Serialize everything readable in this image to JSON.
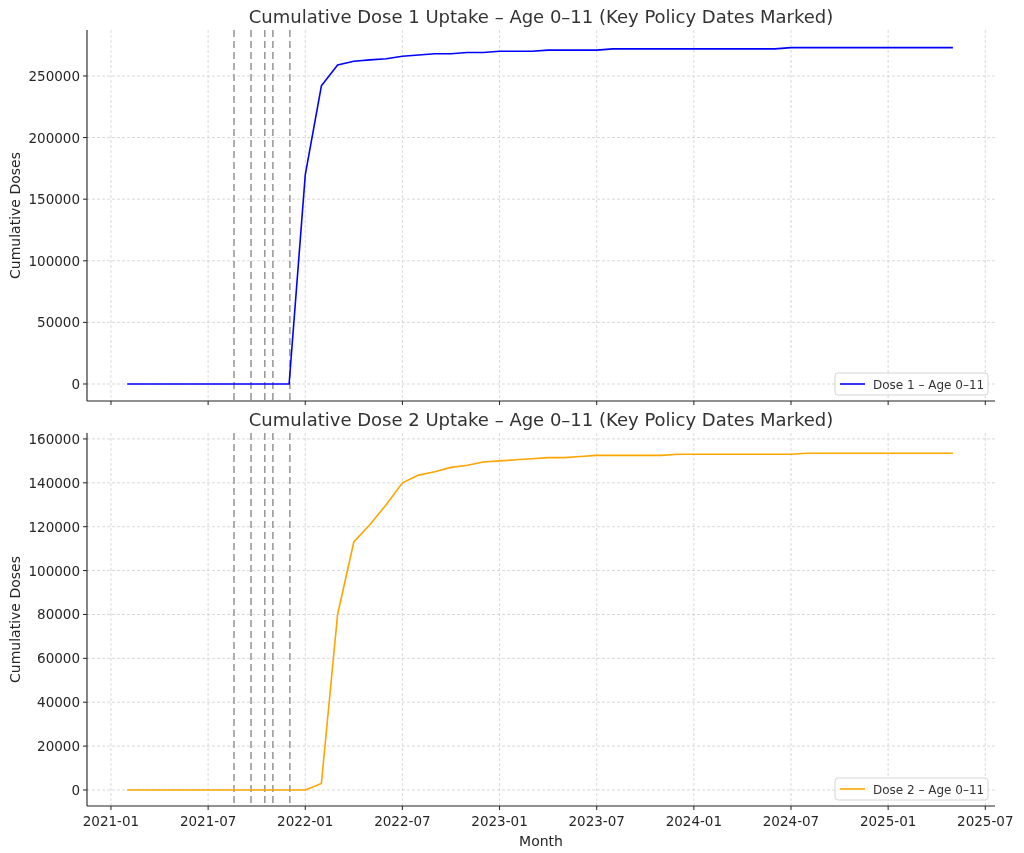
{
  "charts": [
    {
      "chart_data": {
        "type": "line",
        "title": "Cumulative Dose 1 Uptake – Age 0–11 (Key Policy Dates Marked)",
        "ylabel": "Cumulative Doses",
        "categories": [
          null,
          null,
          null,
          null,
          null,
          null,
          null,
          null,
          null,
          null,
          null,
          null,
          null,
          null,
          null,
          null,
          null,
          null,
          null,
          null,
          null,
          null,
          null,
          null,
          null,
          null,
          null,
          null,
          null,
          null,
          null,
          null,
          null,
          null,
          null,
          null,
          null,
          null,
          null,
          null,
          null,
          null,
          null,
          null,
          null,
          null,
          null,
          null,
          null,
          null,
          null,
          null,
          null,
          null,
          null
        ],
        "series": [
          {
            "name": "Dose 1 – Age 0–11",
            "color": "#0000ff",
            "values": [
              null,
              0,
              0,
              0,
              0,
              0,
              0,
              0,
              0,
              0,
              0,
              0,
              170000,
              242000,
              259000,
              262000,
              263000,
              264000,
              266000,
              267000,
              268000,
              268000,
              269000,
              269000,
              270000,
              270000,
              270000,
              271000,
              271000,
              271000,
              271000,
              272000,
              272000,
              272000,
              272000,
              272000,
              272000,
              272000,
              272000,
              272000,
              272000,
              272000,
              273000,
              273000,
              273000,
              273000,
              273000,
              273000,
              273000,
              273000,
              273000,
              273000,
              273000,
              null,
              null
            ]
          }
        ],
        "ylim": [
          -13800,
          287300
        ],
        "grid": true,
        "yticks": [
          0,
          50000,
          100000,
          150000,
          200000,
          250000
        ]
      }
    },
    {
      "chart_data": {
        "type": "line",
        "title": "Cumulative Dose 2 Uptake – Age 0–11 (Key Policy Dates Marked)",
        "xlabel": "Month",
        "ylabel": "Cumulative Doses",
        "categories": [
          "2021-01",
          null,
          null,
          null,
          null,
          null,
          "2021-07",
          null,
          null,
          null,
          null,
          null,
          "2022-01",
          null,
          null,
          null,
          null,
          null,
          "2022-07",
          null,
          null,
          null,
          null,
          null,
          "2023-01",
          null,
          null,
          null,
          null,
          null,
          "2023-07",
          null,
          null,
          null,
          null,
          null,
          "2024-01",
          null,
          null,
          null,
          null,
          null,
          "2024-07",
          null,
          null,
          null,
          null,
          null,
          "2025-01",
          null,
          null,
          null,
          null,
          null,
          "2025-07"
        ],
        "series": [
          {
            "name": "Dose 2 – Age 0–11",
            "color": "#ffa500",
            "values": [
              null,
              0,
              0,
              0,
              0,
              0,
              0,
              0,
              0,
              0,
              0,
              0,
              0,
              3000,
              80000,
              113000,
              121000,
              130000,
              140000,
              143500,
              145000,
              147000,
              148000,
              149500,
              150000,
              150500,
              151000,
              151500,
              151500,
              152000,
              152500,
              152500,
              152500,
              152500,
              152500,
              153000,
              153000,
              153000,
              153000,
              153000,
              153000,
              153000,
              153000,
              153500,
              153500,
              153500,
              153500,
              153500,
              153500,
              153500,
              153500,
              153500,
              153500,
              null,
              null
            ]
          }
        ],
        "ylim": [
          -7300,
          162700
        ],
        "grid": true,
        "yticks": [
          0,
          20000,
          40000,
          60000,
          80000,
          100000,
          120000,
          140000,
          160000
        ]
      }
    }
  ]
}
